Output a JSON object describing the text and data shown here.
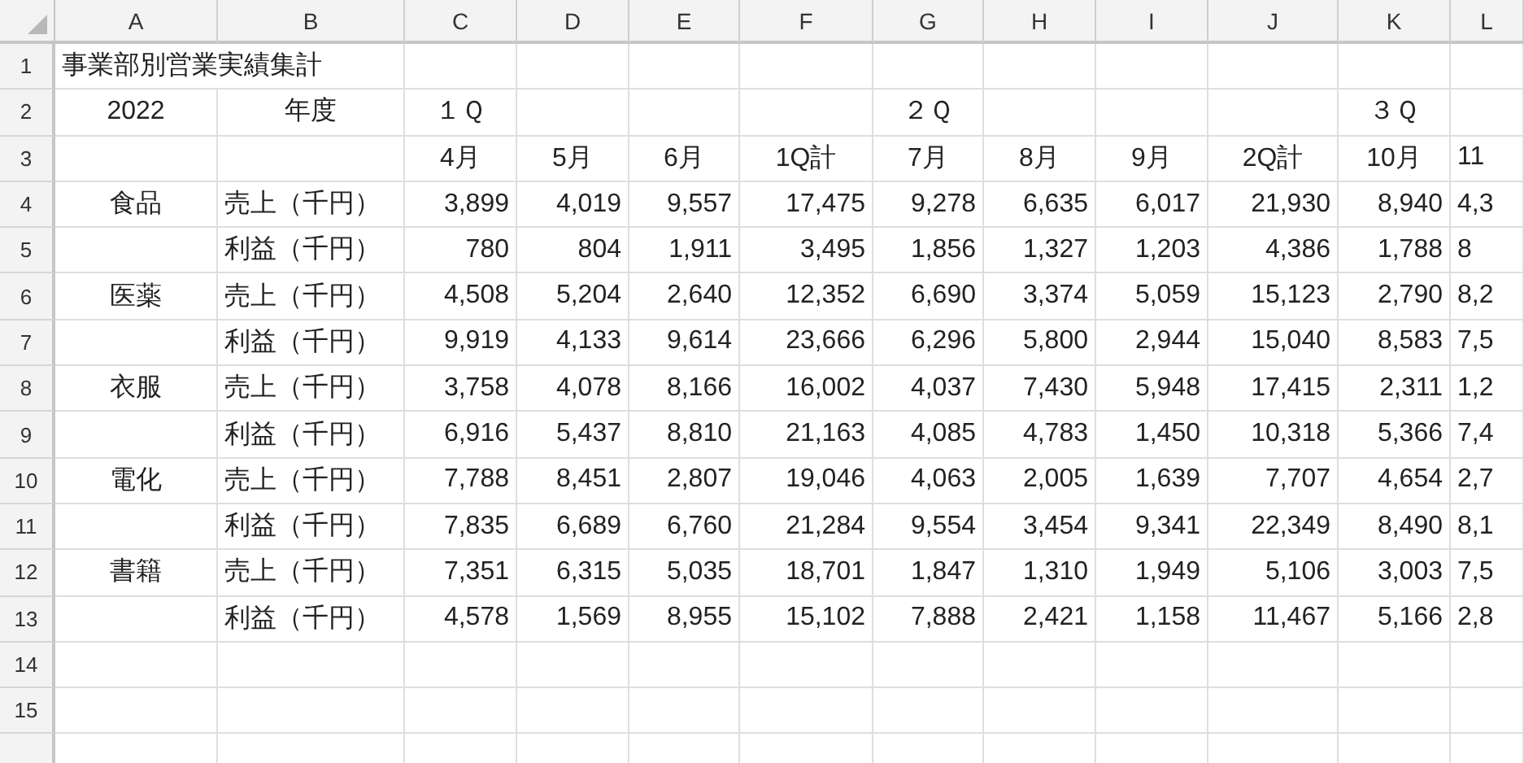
{
  "columns": [
    "A",
    "B",
    "C",
    "D",
    "E",
    "F",
    "G",
    "H",
    "I",
    "J",
    "K",
    "L"
  ],
  "rows": [
    {
      "header": "1",
      "kind": "title",
      "cells": [
        "事業部別営業実績集計"
      ]
    },
    {
      "header": "2",
      "kind": "label",
      "cells": [
        "2022",
        "年度",
        "１Ｑ",
        null,
        null,
        null,
        "２Ｑ",
        null,
        null,
        null,
        "３Ｑ",
        null
      ]
    },
    {
      "header": "3",
      "kind": "label",
      "cells": [
        null,
        null,
        "4月",
        "5月",
        "6月",
        "1Q計",
        "7月",
        "8月",
        "9月",
        "2Q計",
        "10月",
        "11"
      ]
    },
    {
      "header": "4",
      "kind": "data",
      "cells": [
        "食品",
        "売上（千円）",
        "3,899",
        "4,019",
        "9,557",
        "17,475",
        "9,278",
        "6,635",
        "6,017",
        "21,930",
        "8,940",
        "4,3"
      ]
    },
    {
      "header": "5",
      "kind": "data",
      "cells": [
        null,
        "利益（千円）",
        "780",
        "804",
        "1,911",
        "3,495",
        "1,856",
        "1,327",
        "1,203",
        "4,386",
        "1,788",
        "8"
      ]
    },
    {
      "header": "6",
      "kind": "data",
      "cells": [
        "医薬",
        "売上（千円）",
        "4,508",
        "5,204",
        "2,640",
        "12,352",
        "6,690",
        "3,374",
        "5,059",
        "15,123",
        "2,790",
        "8,2"
      ]
    },
    {
      "header": "7",
      "kind": "data",
      "cells": [
        null,
        "利益（千円）",
        "9,919",
        "4,133",
        "9,614",
        "23,666",
        "6,296",
        "5,800",
        "2,944",
        "15,040",
        "8,583",
        "7,5"
      ]
    },
    {
      "header": "8",
      "kind": "data",
      "cells": [
        "衣服",
        "売上（千円）",
        "3,758",
        "4,078",
        "8,166",
        "16,002",
        "4,037",
        "7,430",
        "5,948",
        "17,415",
        "2,311",
        "1,2"
      ]
    },
    {
      "header": "9",
      "kind": "data",
      "cells": [
        null,
        "利益（千円）",
        "6,916",
        "5,437",
        "8,810",
        "21,163",
        "4,085",
        "4,783",
        "1,450",
        "10,318",
        "5,366",
        "7,4"
      ]
    },
    {
      "header": "10",
      "kind": "data",
      "cells": [
        "電化",
        "売上（千円）",
        "7,788",
        "8,451",
        "2,807",
        "19,046",
        "4,063",
        "2,005",
        "1,639",
        "7,707",
        "4,654",
        "2,7"
      ]
    },
    {
      "header": "11",
      "kind": "data",
      "cells": [
        null,
        "利益（千円）",
        "7,835",
        "6,689",
        "6,760",
        "21,284",
        "9,554",
        "3,454",
        "9,341",
        "22,349",
        "8,490",
        "8,1"
      ]
    },
    {
      "header": "12",
      "kind": "data",
      "cells": [
        "書籍",
        "売上（千円）",
        "7,351",
        "6,315",
        "5,035",
        "18,701",
        "1,847",
        "1,310",
        "1,949",
        "5,106",
        "3,003",
        "7,5"
      ]
    },
    {
      "header": "13",
      "kind": "data",
      "cells": [
        null,
        "利益（千円）",
        "4,578",
        "1,569",
        "8,955",
        "15,102",
        "7,888",
        "2,421",
        "1,158",
        "11,467",
        "5,166",
        "2,8"
      ]
    },
    {
      "header": "14",
      "kind": "blank"
    },
    {
      "header": "15",
      "kind": "blank"
    }
  ]
}
